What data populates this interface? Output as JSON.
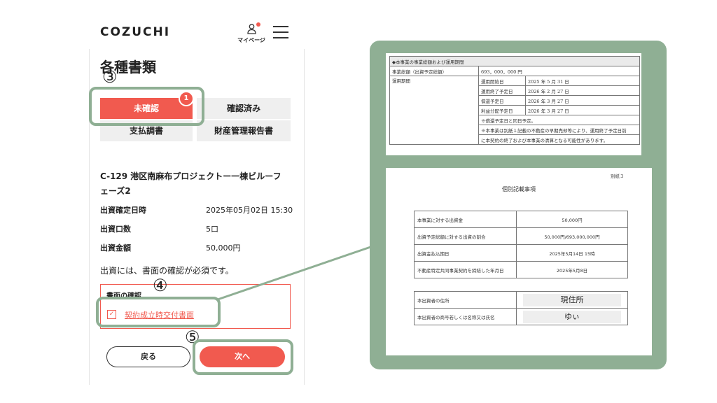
{
  "header": {
    "logo": "COZUCHI",
    "mypage_label": "マイページ"
  },
  "page": {
    "title": "各種書類",
    "tabs": [
      {
        "label": "未確認",
        "active": true,
        "badge": "1"
      },
      {
        "label": "確認済み",
        "active": false
      },
      {
        "label": "支払調書",
        "active": false
      },
      {
        "label": "財産管理報告書",
        "active": false
      }
    ],
    "project_name": "C-129 港区南麻布プロジェクトー一棟ビルーフェーズ2",
    "details": [
      {
        "label": "出資確定日時",
        "value": "2025年05月02日 15:30"
      },
      {
        "label": "出資口数",
        "value": "5口"
      },
      {
        "label": "出資金額",
        "value": "50,000円"
      }
    ],
    "notice": "出資には、書面の確認が必須です。",
    "confirm_title": "書面の確認",
    "checkbox_mark": "✓",
    "document_link": "契約成立時交付書面",
    "back_button": "戻る",
    "next_button": "次へ"
  },
  "annotations": {
    "step3": "③",
    "step4": "④",
    "step5": "⑤"
  },
  "doc1": {
    "heading": "◆本事業の事業総額および運用期間",
    "total_label": "事業総額（出資予定総額）",
    "total_value": "693，000，000 円",
    "period_label": "運用期間",
    "rows": [
      {
        "label": "運用開始日",
        "value": "2025 年 5 月 31 日"
      },
      {
        "label": "運用終了予定日",
        "value": "2026 年 2 月 27 日"
      },
      {
        "label": "償還予定日",
        "value": "2026 年 3 月 27 日"
      },
      {
        "label": "利益分配予定日",
        "value": "2026 年 3 月 27 日"
      }
    ],
    "note1": "※償還予定日と同日予定。",
    "note2": "※本事業は別紙１記載の不動産の早期売却等により、運用終了予定日前",
    "note3": "に本契約の終了および本事業の清算となる可能性があります。"
  },
  "doc2": {
    "attachment": "別紙３",
    "title": "個別記載事項",
    "rows": [
      {
        "label": "本事業に対する出資金",
        "value": "50,000円"
      },
      {
        "label": "出資予定総額に対する出資の割合",
        "value": "50,000円/693,000,000円"
      },
      {
        "label": "出資金払込期日",
        "value": "2025年5月14日 15時"
      },
      {
        "label": "不動産特定共同事業契約を締結した年月日",
        "value": "2025年5月8日"
      }
    ],
    "investor_rows": [
      {
        "label": "本出資者の住所",
        "value": "現住所"
      },
      {
        "label": "本出資者の商号若しくは名称又は氏名",
        "value": "ゆぃ"
      }
    ]
  },
  "colors": {
    "accent": "#f15a4f",
    "highlight": "#8faf94"
  }
}
